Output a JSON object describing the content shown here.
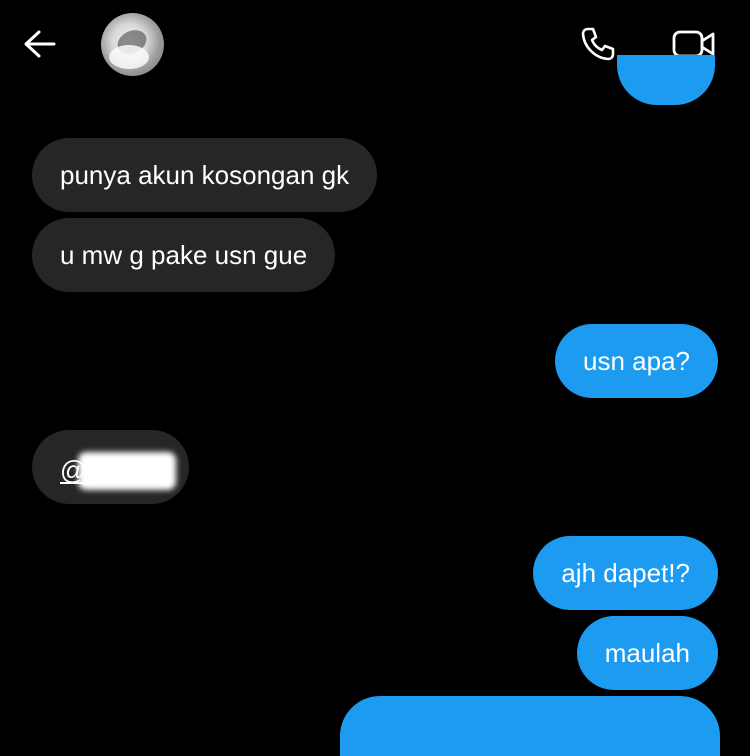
{
  "header": {
    "back_icon": "arrow-left-icon",
    "call_icon": "phone-icon",
    "video_icon": "video-camera-icon"
  },
  "messages": [
    {
      "side": "received",
      "text": "punya akun kosongan gk"
    },
    {
      "side": "received",
      "text": "u mw g pake usn gue"
    },
    {
      "side": "sent",
      "text": "usn apa?"
    },
    {
      "side": "received",
      "text": "@"
    },
    {
      "side": "sent",
      "text": "ajh dapet!?"
    },
    {
      "side": "sent",
      "text": "maulah"
    }
  ],
  "colors": {
    "background": "#000000",
    "sent_bubble": "#1d9bf0",
    "received_bubble": "#262626",
    "text": "#ffffff"
  }
}
